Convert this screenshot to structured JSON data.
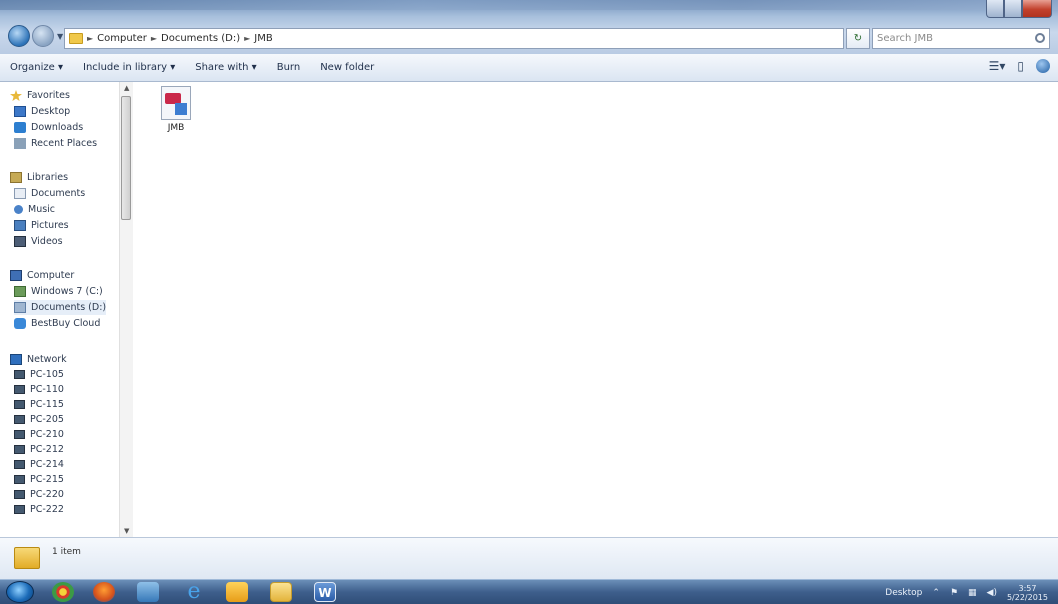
{
  "window": {
    "address": {
      "breadcrumbs": [
        "Computer",
        "Documents (D:)",
        "JMB"
      ],
      "search_placeholder": "Search JMB"
    },
    "commandbar": {
      "items": [
        "Organize ▾",
        "Include in library ▾",
        "Share with ▾",
        "Burn",
        "New folder"
      ]
    }
  },
  "navpane": {
    "items": [
      {
        "label": "Favorites",
        "icon": "star-icon"
      },
      {
        "label": "Desktop",
        "icon": "desktop-icon"
      },
      {
        "label": "Downloads",
        "icon": "downloads-icon"
      },
      {
        "label": "Recent Places",
        "icon": "recent-places-icon"
      },
      {
        "label": "Libraries",
        "icon": "libraries-icon"
      },
      {
        "label": "Documents",
        "icon": "documents-icon"
      },
      {
        "label": "Music",
        "icon": "music-icon"
      },
      {
        "label": "Pictures",
        "icon": "pictures-icon"
      },
      {
        "label": "Videos",
        "icon": "videos-icon"
      },
      {
        "label": "Computer",
        "icon": "computer-icon"
      },
      {
        "label": "Windows 7 (C:)",
        "icon": "drive-icon"
      },
      {
        "label": "Documents (D:)",
        "icon": "drive-icon"
      },
      {
        "label": "BestBuy Cloud",
        "icon": "cloud-icon"
      },
      {
        "label": "Network",
        "icon": "network-icon"
      },
      {
        "label": "PC-105",
        "icon": "pc-icon"
      },
      {
        "label": "PC-110",
        "icon": "pc-icon"
      },
      {
        "label": "PC-115",
        "icon": "pc-icon"
      },
      {
        "label": "PC-205",
        "icon": "pc-icon"
      },
      {
        "label": "PC-210",
        "icon": "pc-icon"
      },
      {
        "label": "PC-212",
        "icon": "pc-icon"
      },
      {
        "label": "PC-214",
        "icon": "pc-icon"
      },
      {
        "label": "PC-215",
        "icon": "pc-icon"
      },
      {
        "label": "PC-220",
        "icon": "pc-icon"
      },
      {
        "label": "PC-222",
        "icon": "pc-icon"
      }
    ]
  },
  "content": {
    "files": [
      {
        "name": "JMB",
        "icon": "access-database-icon"
      }
    ]
  },
  "details": {
    "item_count": "1 item"
  },
  "taskbar": {
    "apps": [
      "Chrome",
      "Firefox",
      "Windows Media Player",
      "Internet Explorer",
      "Outlook",
      "Windows Explorer",
      "Word"
    ],
    "tray_label": "Desktop",
    "time": "3:57",
    "date": "5/22/2015"
  }
}
